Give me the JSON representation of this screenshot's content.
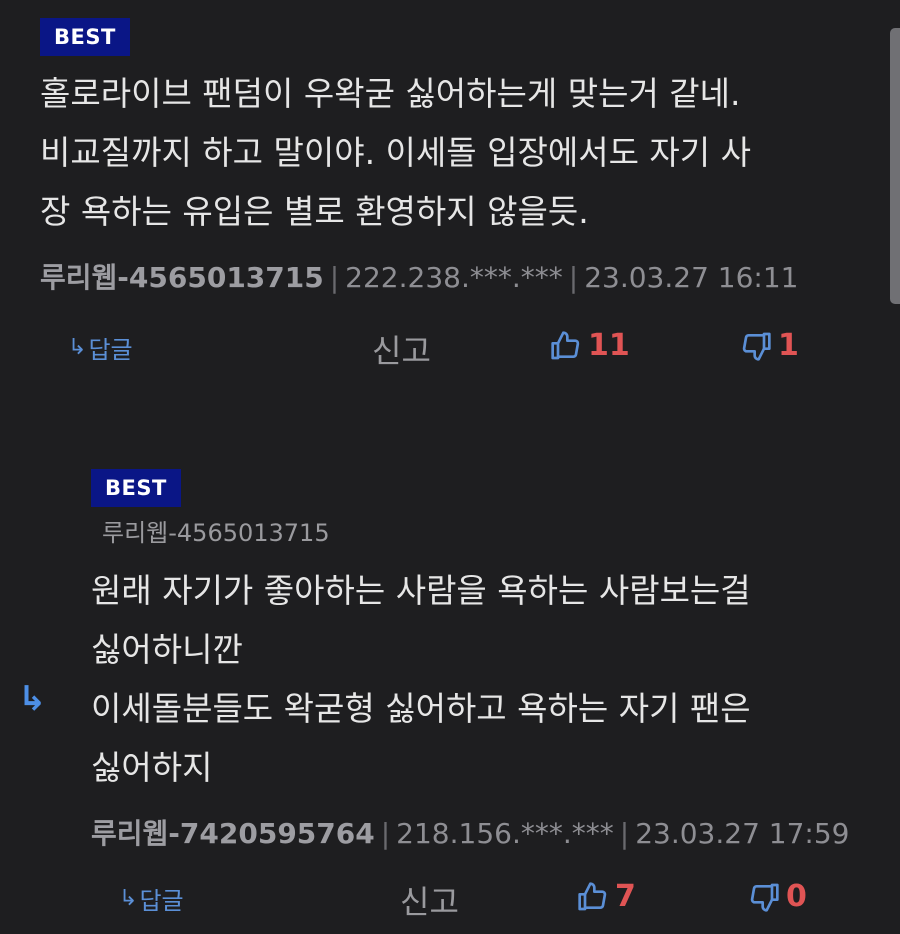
{
  "comments": [
    {
      "badge": "BEST",
      "text": "홀로라이브 팬덤이 우왁굳 싫어하는게 맞는거 같네.\n비교질까지 하고 말이야. 이세돌 입장에서도 자기 사\n장 욕하는 유입은 별로 환영하지 않을듯.",
      "author": "루리웹-4565013715",
      "ip": "222.238.***.***",
      "date": "23.03.27 16:11",
      "reply_label": "답글",
      "report_label": "신고",
      "likes": "11",
      "dislikes": "1"
    },
    {
      "badge": "BEST",
      "quoted_user": "루리웹-4565013715",
      "text": "원래 자기가 좋아하는 사람을 욕하는 사람보는걸\n싫어하니깐\n이세돌분들도 왁굳형 싫어하고 욕하는 자기 팬은\n싫어하지",
      "author": "루리웹-7420595764",
      "ip": "218.156.***.***",
      "date": "23.03.27 17:59",
      "reply_label": "답글",
      "report_label": "신고",
      "likes": "7",
      "dislikes": "0"
    }
  ],
  "icons": {
    "reply": "reply-arrow-icon",
    "like": "thumbs-up-icon",
    "dislike": "thumbs-down-icon",
    "nested": "nested-reply-arrow-icon"
  },
  "colors": {
    "background": "#1e1e20",
    "badge": "#0a1686",
    "accent_blue": "#5b8fd6",
    "count_red": "#e05454"
  }
}
